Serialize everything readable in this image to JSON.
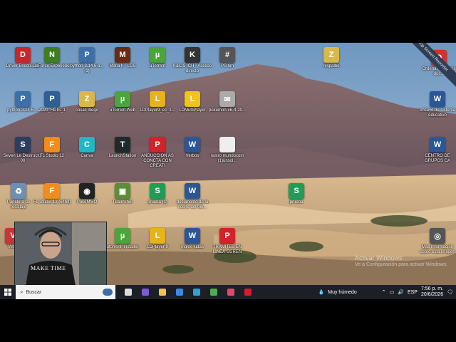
{
  "colors": {
    "taskbar": "#1c1f26",
    "sky": "#8fb2d1",
    "mountain": "#6e5a63",
    "sand": "#c9a77c"
  },
  "desktop": {
    "icons": [
      {
        "label": "Driver Booster 13",
        "icon": "gauge-icon",
        "color": "#c6282b",
        "glyph": "D"
      },
      {
        "label": "GeForce Experience",
        "icon": "nvidia-icon",
        "color": "#3f7d1e",
        "glyph": "N"
      },
      {
        "label": "python-3.14.6-a... (1)",
        "icon": "python-installer-icon",
        "color": "#3d6fa8",
        "glyph": "P"
      },
      {
        "label": "Mafia II - LGS",
        "icon": "mafia-icon",
        "color": "#6b2b12",
        "glyph": "M"
      },
      {
        "label": "µTorrent",
        "icon": "utorrent-icon",
        "color": "#4aa63b",
        "glyph": "µ"
      },
      {
        "label": "KaiOS ICH - Acceso directo",
        "icon": "kaios-icon",
        "color": "#333",
        "glyph": "K"
      },
      {
        "label": "PS-tim",
        "icon": "grid-icon",
        "color": "#555",
        "glyph": "#"
      },
      {
        "label": "reypalbo",
        "icon": "zip-folder-icon",
        "color": "#d9b84a",
        "glyph": "Z"
      },
      {
        "label": "Ordenar numeros dos...",
        "icon": "app-red-icon",
        "color": "#c33",
        "glyph": "O"
      },
      {
        "label": "python-3.14.6-...",
        "icon": "python-icon",
        "color": "#3d6fa8",
        "glyph": "P"
      },
      {
        "label": "2020_HDIS_1",
        "icon": "python-icon",
        "color": "#2e5f95",
        "glyph": "P"
      },
      {
        "label": "cosas diego",
        "icon": "zip-folder-icon",
        "color": "#d9b84a",
        "glyph": "Z"
      },
      {
        "label": "uTorrent Web",
        "icon": "utorrent-icon",
        "color": "#4aa63b",
        "glyph": "µ"
      },
      {
        "label": "LDPlayer9_es_1...",
        "icon": "ldplayer-icon",
        "color": "#e8b21c",
        "glyph": "L"
      },
      {
        "label": "LDMultiPlayer",
        "icon": "ldplayer-icon",
        "color": "#f0c419",
        "glyph": "L"
      },
      {
        "label": "pokemon-v6-4-20...",
        "icon": "mail-icon",
        "color": "#aaa",
        "glyph": "✉"
      },
      {
        "label": "ensayo de sistema educativo",
        "icon": "word-icon",
        "color": "#2b5797",
        "glyph": "W"
      },
      {
        "label": "Seven Le Destructor 00",
        "icon": "folder-icon",
        "color": "#2c3e60",
        "glyph": "S"
      },
      {
        "label": "FL Studio 12",
        "icon": "flstudio-icon",
        "color": "#f28c1a",
        "glyph": "F"
      },
      {
        "label": "Canva",
        "icon": "canva-icon",
        "color": "#20b8c7",
        "glyph": "C"
      },
      {
        "label": "LaunchStation",
        "icon": "launcher-icon",
        "color": "#1e2a2a",
        "glyph": "T"
      },
      {
        "label": "ANDUCCION AS CONCTA CON CREATI",
        "icon": "pdf-icon",
        "color": "#d0232a",
        "glyph": "P"
      },
      {
        "label": "Verbos",
        "icon": "word-icon",
        "color": "#2b5797",
        "glyph": "W"
      },
      {
        "label": "rastro mundocom (1)unsol...",
        "icon": "document-icon",
        "color": "#eee",
        "glyph": " "
      },
      {
        "label": "CENTRO DE GRUPOS CA",
        "icon": "word-icon",
        "color": "#2b5797",
        "glyph": "W"
      },
      {
        "label": "Papelera de reciclaje",
        "icon": "recycle-bin-icon",
        "color": "#6b8fb7",
        "glyph": "♻"
      },
      {
        "label": "FL Studio 12 (64bit)",
        "icon": "flstudio-icon",
        "color": "#f28c1a",
        "glyph": "F"
      },
      {
        "label": "PokeMMO",
        "icon": "pokeball-icon",
        "color": "#222",
        "glyph": "◉"
      },
      {
        "label": "TLauncher",
        "icon": "minecraft-icon",
        "color": "#5a8f3a",
        "glyph": "▣"
      },
      {
        "label": "prueba (1)",
        "icon": "sheets-icon",
        "color": "#1f9d55",
        "glyph": "S"
      },
      {
        "label": "documento de la noche del 08/...",
        "icon": "word-icon",
        "color": "#2b5797",
        "glyph": "W"
      },
      {
        "label": "prueba",
        "icon": "sheets-icon",
        "color": "#1f9d55",
        "glyph": "S"
      },
      {
        "label": "Virt...",
        "icon": "app-red-icon",
        "color": "#c33",
        "glyph": "V"
      },
      {
        "label": "utorrent_installer",
        "icon": "utorrent-icon",
        "color": "#4aa63b",
        "glyph": "µ"
      },
      {
        "label": "LDPlayer 9",
        "icon": "ldplayer-icon",
        "color": "#e8b21c",
        "glyph": "L"
      },
      {
        "label": "ingles judas",
        "icon": "word-icon",
        "color": "#2b5797",
        "glyph": "W"
      },
      {
        "label": "TRAMITES EN LINEA-SUREN",
        "icon": "pdf-icon",
        "color": "#d0232a",
        "glyph": "P"
      },
      {
        "label": "Más información sobre esta imagen",
        "icon": "camera-icon",
        "color": "#555",
        "glyph": "◎"
      }
    ]
  },
  "ribbon": {
    "text": "iTop Screen Recorder"
  },
  "watermark": {
    "line1": "Activar Windows",
    "line2": "Ve a Configuración para activar Windows."
  },
  "webcam": {
    "shirt_text": "MAKE TIME"
  },
  "taskbar": {
    "search_placeholder": "Buscar",
    "weather": "Muy húmedo",
    "time": "7:56 p. m.",
    "date": "20/6/2026",
    "apps": [
      {
        "name": "task-view-icon",
        "color": "#ddd"
      },
      {
        "name": "copilot-icon",
        "color": "#7b5cd6"
      },
      {
        "name": "file-explorer-icon",
        "color": "#f2c14e"
      },
      {
        "name": "store-icon",
        "color": "#3a8be0"
      },
      {
        "name": "edge-icon",
        "color": "#2aa3d7"
      },
      {
        "name": "chrome-icon",
        "color": "#4caf50"
      },
      {
        "name": "recorder-icon",
        "color": "#e04a6a"
      },
      {
        "name": "opera-icon",
        "color": "#d21f2b"
      }
    ]
  }
}
